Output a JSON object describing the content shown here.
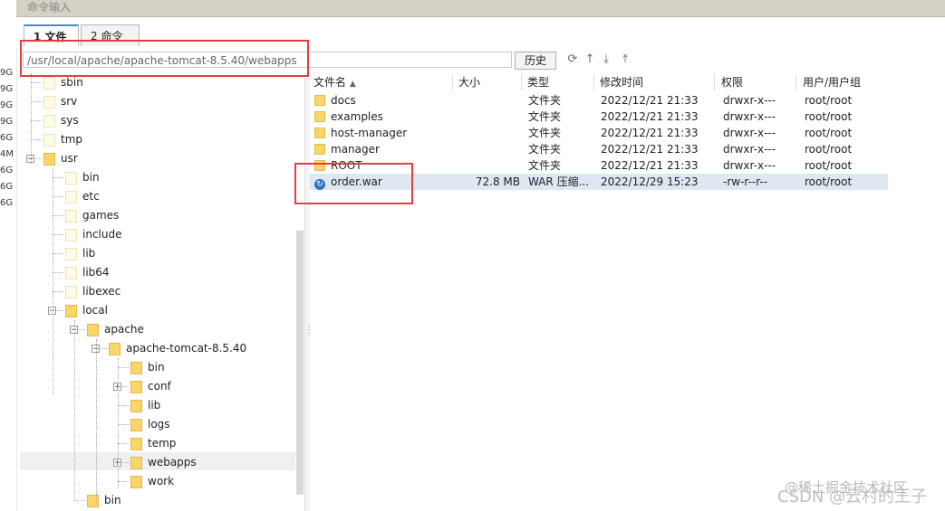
{
  "window": {
    "title": "命令输入"
  },
  "left_strip": {
    "values": [
      "9G",
      "9G",
      "9G",
      "9G",
      "6G",
      "4M",
      "6G",
      "6G",
      "6G"
    ]
  },
  "tabs": [
    {
      "label": "1 文件"
    },
    {
      "label": "2 命令"
    }
  ],
  "path": {
    "value": "/usr/local/apache/apache-tomcat-8.5.40/webapps"
  },
  "toolbar": {
    "history_label": "历史",
    "icons": [
      "refresh-icon",
      "up-arrow-icon",
      "download-icon",
      "upload-icon"
    ]
  },
  "tree": [
    {
      "label": "sbin",
      "depth": 0
    },
    {
      "label": "srv",
      "depth": 0
    },
    {
      "label": "sys",
      "depth": 0
    },
    {
      "label": "tmp",
      "depth": 0
    },
    {
      "label": "usr",
      "depth": 0,
      "expander": "minus"
    },
    {
      "label": "bin",
      "depth": 1
    },
    {
      "label": "etc",
      "depth": 1
    },
    {
      "label": "games",
      "depth": 1
    },
    {
      "label": "include",
      "depth": 1
    },
    {
      "label": "lib",
      "depth": 1
    },
    {
      "label": "lib64",
      "depth": 1
    },
    {
      "label": "libexec",
      "depth": 1
    },
    {
      "label": "local",
      "depth": 1,
      "expander": "minus"
    },
    {
      "label": "apache",
      "depth": 2,
      "expander": "minus"
    },
    {
      "label": "apache-tomcat-8.5.40",
      "depth": 3,
      "expander": "minus"
    },
    {
      "label": "bin",
      "depth": 4
    },
    {
      "label": "conf",
      "depth": 4,
      "expander": "plus"
    },
    {
      "label": "lib",
      "depth": 4
    },
    {
      "label": "logs",
      "depth": 4
    },
    {
      "label": "temp",
      "depth": 4
    },
    {
      "label": "webapps",
      "depth": 4,
      "expander": "plus",
      "selected": true
    },
    {
      "label": "work",
      "depth": 4
    },
    {
      "label": "bin",
      "depth": 2
    }
  ],
  "columns": {
    "name": "文件名",
    "size": "大小",
    "type": "类型",
    "modified": "修改时间",
    "perms": "权限",
    "owner": "用户/用户组"
  },
  "files": [
    {
      "name": "docs",
      "size": "",
      "type": "文件夹",
      "modified": "2022/12/21 21:33",
      "perms": "drwxr-x---",
      "owner": "root/root",
      "icon": "folder"
    },
    {
      "name": "examples",
      "size": "",
      "type": "文件夹",
      "modified": "2022/12/21 21:33",
      "perms": "drwxr-x---",
      "owner": "root/root",
      "icon": "folder"
    },
    {
      "name": "host-manager",
      "size": "",
      "type": "文件夹",
      "modified": "2022/12/21 21:33",
      "perms": "drwxr-x---",
      "owner": "root/root",
      "icon": "folder"
    },
    {
      "name": "manager",
      "size": "",
      "type": "文件夹",
      "modified": "2022/12/21 21:33",
      "perms": "drwxr-x---",
      "owner": "root/root",
      "icon": "folder"
    },
    {
      "name": "ROOT",
      "size": "",
      "type": "文件夹",
      "modified": "2022/12/21 21:33",
      "perms": "drwxr-x---",
      "owner": "root/root",
      "icon": "folder"
    },
    {
      "name": "order.war",
      "size": "72.8 MB",
      "type": "WAR 压缩...",
      "modified": "2022/12/29 15:23",
      "perms": "-rw-r--r--",
      "owner": "root/root",
      "icon": "war",
      "selected": true
    }
  ],
  "watermark": {
    "line1": "@稀土掘金技术社区",
    "line2": "CSDN @云村的王子"
  }
}
